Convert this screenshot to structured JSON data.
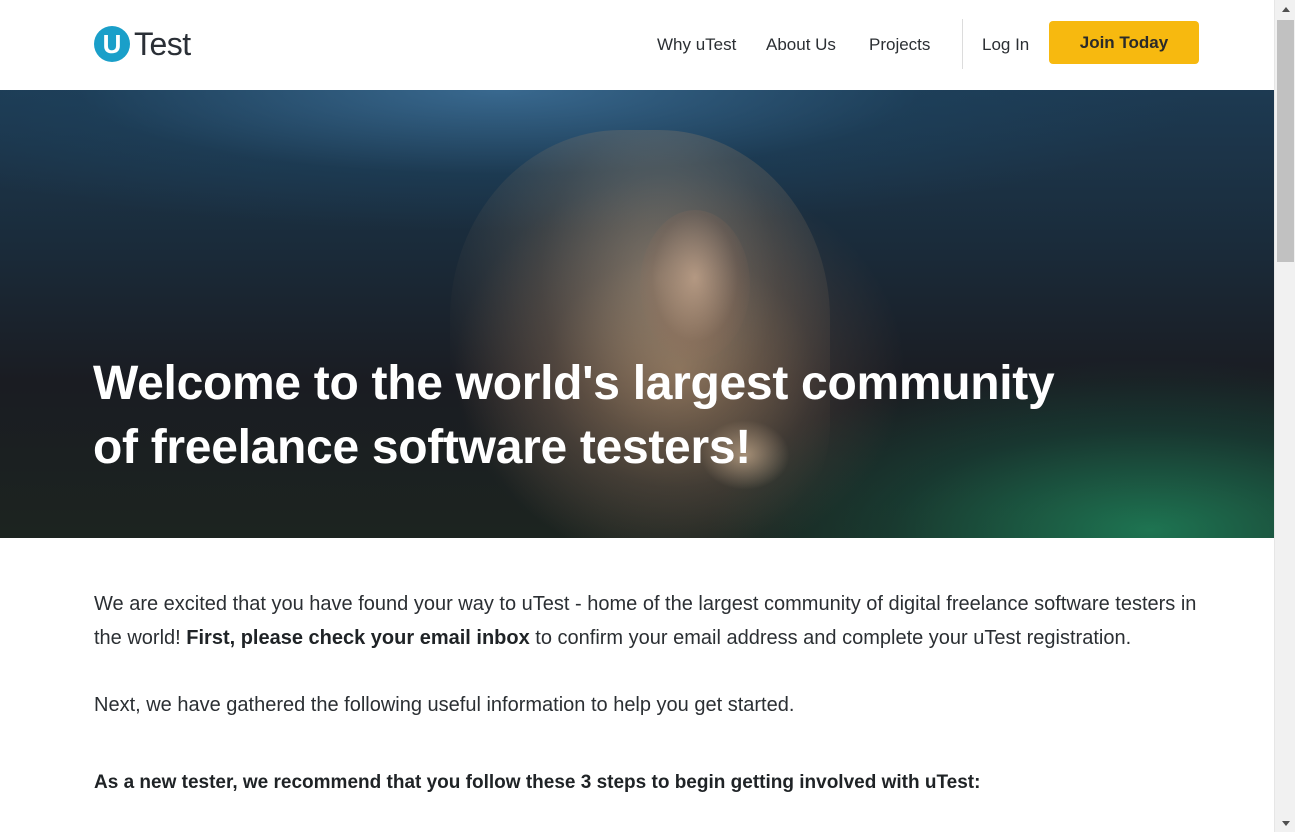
{
  "header": {
    "logo_mark": "U",
    "logo_text": "Test",
    "nav": {
      "why": "Why uTest",
      "about": "About Us",
      "projects": "Projects",
      "login": "Log In",
      "join": "Join Today"
    }
  },
  "hero": {
    "title_line1": "Welcome to the world's largest community",
    "title_line2": "of freelance software testers!"
  },
  "content": {
    "para1_start": "We are excited that you have found your way to uTest - home of the largest community of digital freelance software testers in the world! ",
    "para1_bold": "First, please check your email inbox",
    "para1_end": " to confirm your email address and complete your uTest registration.",
    "para2": "Next, we have gathered the following useful information to help you get started.",
    "steps_intro": "As a new tester, we recommend that you follow these 3 steps to begin getting involved with uTest:"
  },
  "colors": {
    "brand_blue": "#1a9fc9",
    "join_button": "#f7b90f"
  }
}
